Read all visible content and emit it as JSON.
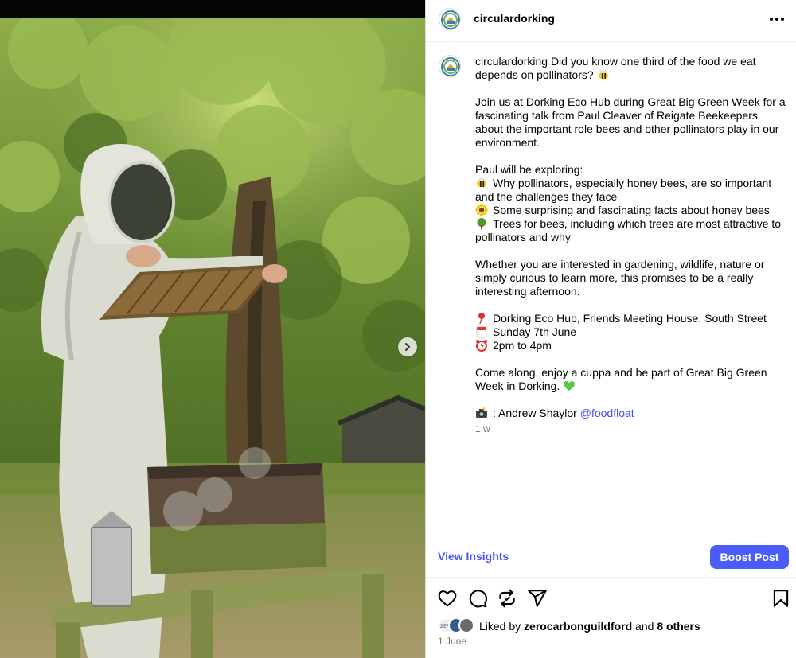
{
  "post": {
    "username": "circulardorking",
    "caption_user": "circulardorking",
    "caption_lines": [
      {
        "text": "Did you know one third of the food we eat"
      },
      {
        "text": "depends on pollinators?",
        "emoji_after": "bee"
      },
      {
        "text": ""
      },
      {
        "text": "Join us at Dorking Eco Hub during Great Big Green Week for a"
      },
      {
        "text": "fascinating talk from Paul Cleaver of Reigate Beekeepers"
      },
      {
        "text": "about the important role bees and other pollinators play in our"
      },
      {
        "text": "environment."
      },
      {
        "text": ""
      },
      {
        "text": "Paul will be exploring:"
      },
      {
        "text": "Why pollinators, especially honey bees, are so important",
        "emoji": "bee"
      },
      {
        "text": "and the challenges they face"
      },
      {
        "text": "Some surprising and fascinating facts about honey bees",
        "emoji": "sunflower"
      },
      {
        "text": "Trees for bees, including which trees are most attractive to",
        "emoji": "tree"
      },
      {
        "text": "pollinators and why"
      },
      {
        "text": ""
      },
      {
        "text": "Whether you are interested in gardening, wildlife, nature or"
      },
      {
        "text": "simply curious to learn more, this promises to be a really"
      },
      {
        "text": "interesting afternoon."
      },
      {
        "text": ""
      },
      {
        "text": "Dorking Eco Hub, Friends Meeting House, South Street",
        "emoji": "pin"
      },
      {
        "text": "Sunday 7th June",
        "emoji": "calendar"
      },
      {
        "text": "2pm to 4pm",
        "emoji": "alarm-clock"
      },
      {
        "text": ""
      },
      {
        "text": "Come along, enjoy a cuppa and be part of Great Big Green"
      },
      {
        "text": "Week in Dorking.",
        "emoji_after": "green-heart"
      },
      {
        "text": ""
      },
      {
        "text": ": Andrew Shaylor ",
        "emoji": "camera-flash",
        "mention": "@foodfloat"
      }
    ],
    "time_ago": "1 w",
    "view_insights_label": "View Insights",
    "boost_label": "Boost Post",
    "liked_by_prefix": "Liked by ",
    "liked_by_user": "zerocarbonguildford",
    "liked_by_and": " and ",
    "liked_by_others": "8 others",
    "date": "1 June"
  },
  "colors": {
    "link": "#4150f7",
    "boost_bg": "#4a5df9",
    "secondary_text": "#737373"
  },
  "icons": {
    "header": [
      "brand-logo-icon",
      "more-options-icon"
    ],
    "actions": [
      "heart-icon",
      "comment-icon",
      "share-icon",
      "send-icon",
      "bookmark-icon"
    ],
    "media": [
      "next-photo-icon"
    ]
  }
}
